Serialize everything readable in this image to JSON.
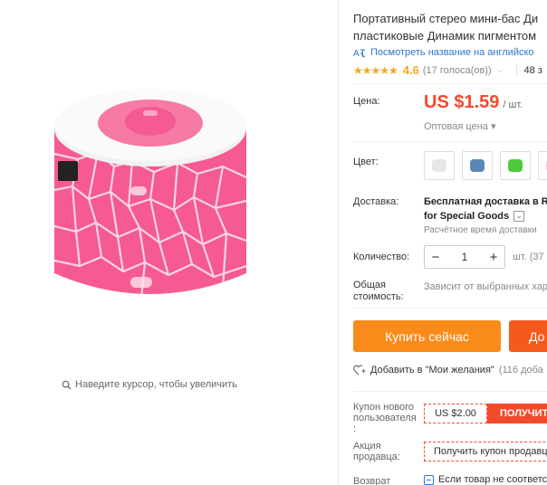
{
  "product": {
    "title_line1": "Портативный стерео мини-бас Ди",
    "title_line2": "пластиковые Динамик пигментом",
    "translate_link": "Посмотреть название на английско",
    "rating": {
      "stars": "★★★★★",
      "value": "4.6",
      "votes": "(17 голоса(ов))",
      "orders": "48 з"
    }
  },
  "gallery": {
    "zoom_hint": "Наведите курсор, чтобы увеличить"
  },
  "price": {
    "label": "Цена:",
    "value": "US $1.59",
    "unit": "/ шт.",
    "wholesale": "Оптовая цена ▾"
  },
  "color": {
    "label": "Цвет:",
    "swatches": [
      {
        "name": "white",
        "color": "#e6e6e6"
      },
      {
        "name": "blue",
        "color": "#5b87b8"
      },
      {
        "name": "green",
        "color": "#4ccc3a"
      },
      {
        "name": "pink",
        "color": "#f7c9d8"
      }
    ]
  },
  "shipping": {
    "label": "Доставка:",
    "line1": "Бесплатная доставка в R",
    "line2": "for Special Goods",
    "sub": "Расчётное время доставки"
  },
  "quantity": {
    "label": "Количество:",
    "value": "1",
    "minus": "−",
    "plus": "+",
    "unit": "шт. (37"
  },
  "total": {
    "label_line1": "Общая",
    "label_line2": "стоимость:",
    "note": "Зависит от выбранных хар"
  },
  "actions": {
    "buy_now": "Купить сейчас",
    "add_to_cart": "До",
    "wishlist": "Добавить в \"Мои желания\"",
    "wishlist_count": "(116 доба"
  },
  "coupons": {
    "new_user_label": [
      "Купон нового",
      "пользователя",
      ":"
    ],
    "new_user_amount": "US $2.00",
    "new_user_button": "ПОЛУЧИТЬ",
    "seller_label": [
      "Акция",
      "продавца:"
    ],
    "seller_button": "Получить купон продавц",
    "return_label": "Возврат",
    "return_text": "Если товар не соответс"
  },
  "colors": {
    "accent": "#f44a2c",
    "buy": "#f98b1a",
    "link": "#2d77c9",
    "star": "#f5a623"
  }
}
